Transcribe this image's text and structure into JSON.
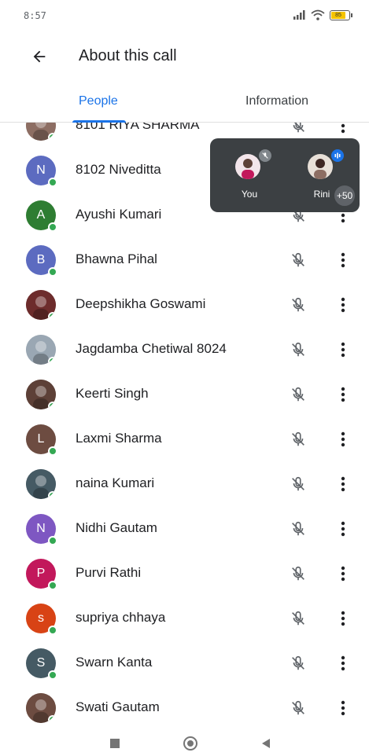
{
  "status_bar": {
    "time": "8:57",
    "battery": "85"
  },
  "app_bar": {
    "title": "About this call"
  },
  "tabs": {
    "people": "People",
    "information": "Information"
  },
  "participants": [
    {
      "name": "8101 RIYA SHARMA",
      "initial": "",
      "color": "#8d6e63",
      "photo": true
    },
    {
      "name": "8102 Niveditta",
      "initial": "N",
      "color": "#5c6bc0",
      "photo": false
    },
    {
      "name": "Ayushi Kumari",
      "initial": "A",
      "color": "#2e7d32",
      "photo": false
    },
    {
      "name": "Bhawna Pihal",
      "initial": "B",
      "color": "#5c6bc0",
      "photo": false
    },
    {
      "name": "Deepshikha Goswami",
      "initial": "",
      "color": "#6d2c2c",
      "photo": true
    },
    {
      "name": "Jagdamba Chetiwal 8024",
      "initial": "",
      "color": "#9aa7b3",
      "photo": true
    },
    {
      "name": "Keerti Singh",
      "initial": "",
      "color": "#5d4037",
      "photo": true
    },
    {
      "name": "Laxmi Sharma",
      "initial": "L",
      "color": "#6d4c41",
      "photo": false
    },
    {
      "name": "naina Kumari",
      "initial": "",
      "color": "#455a64",
      "photo": true
    },
    {
      "name": "Nidhi Gautam",
      "initial": "N",
      "color": "#7e57c2",
      "photo": false
    },
    {
      "name": "Purvi Rathi",
      "initial": "P",
      "color": "#c2185b",
      "photo": false
    },
    {
      "name": "supriya chhaya",
      "initial": "s",
      "color": "#d84315",
      "photo": false
    },
    {
      "name": "Swarn Kanta",
      "initial": "S",
      "color": "#455a64",
      "photo": false
    },
    {
      "name": "Swati Gautam",
      "initial": "",
      "color": "#6d4c41",
      "photo": true
    }
  ],
  "self_view": {
    "you_label": "You",
    "other_label": "Rini",
    "more_count": "+50"
  },
  "icons": {
    "back": "arrow-back-icon",
    "mic_off": "mic-off-icon",
    "more": "more-vert-icon"
  },
  "colors": {
    "accent": "#1a73e8",
    "presence": "#34a853",
    "overlay": "#3c4043"
  }
}
